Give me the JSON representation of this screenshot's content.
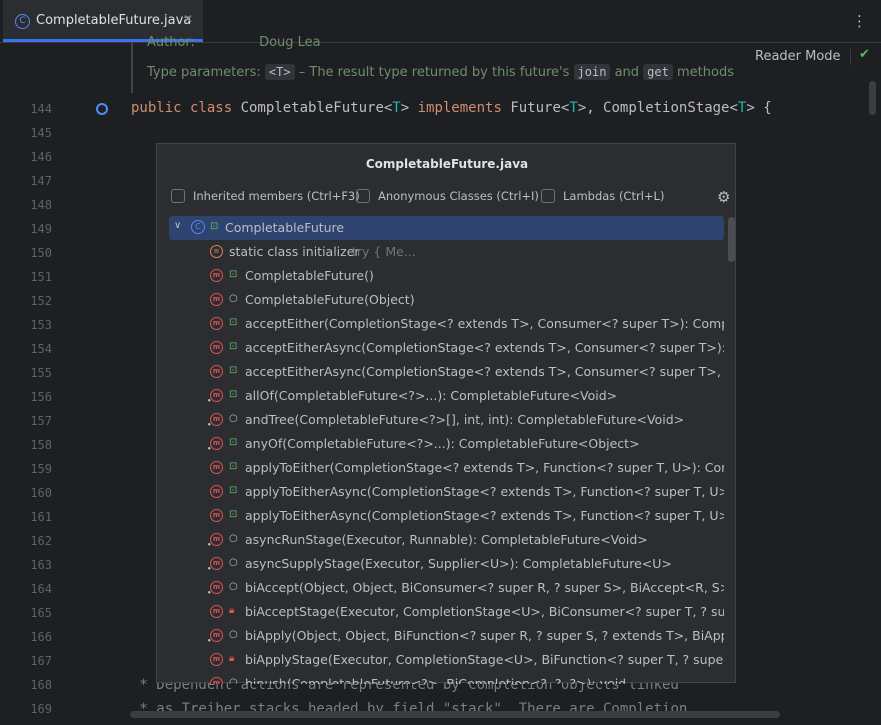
{
  "tab": {
    "title": "CompletableFuture.java",
    "icon": "class-icon",
    "close": "✕"
  },
  "reader_mode": "Reader Mode",
  "doc": {
    "author_label": "Author:",
    "author_value": "Doug Lea",
    "type_params_label": "Type parameters:",
    "type_param_code": "<T>",
    "type_param_desc": " – The result type returned by this future's ",
    "join_code": "join",
    "and_text": " and ",
    "get_code": "get",
    "methods_text": " methods"
  },
  "line_numbers": [
    "144",
    "145",
    "146",
    "147",
    "148",
    "149",
    "150",
    "151",
    "152",
    "153",
    "154",
    "155",
    "156",
    "157",
    "158",
    "159",
    "160",
    "161",
    "162",
    "163",
    "164",
    "165",
    "166",
    "167",
    "168",
    "169"
  ],
  "code": {
    "l144_kw1": "public class ",
    "l144_name": "CompletableFuture<",
    "l144_t1": "T",
    "l144_close1": "> ",
    "l144_impl": "implements ",
    "l144_fut": "Future<",
    "l144_t2": "T",
    "l144_mid": ">, CompletionStage<",
    "l144_t3": "T",
    "l144_end": "> {",
    "l168": " * Dependent actions are represented by Completion objects linked",
    "l169": " * as Treiber stacks headed by field \"stack\". There are Completion"
  },
  "popup": {
    "title": "CompletableFuture.java",
    "options": [
      "Inherited members (Ctrl+F3)",
      "Anonymous Classes (Ctrl+I)",
      "Lambdas (Ctrl+L)"
    ],
    "root": "CompletableFuture",
    "members": [
      {
        "kind": "static",
        "vis": "none",
        "label": "static class initializer",
        "extra": "try {            Me..."
      },
      {
        "kind": "method",
        "vis": "pub",
        "label": "CompletableFuture()"
      },
      {
        "kind": "method",
        "vis": "pkg",
        "label": "CompletableFuture(Object)"
      },
      {
        "kind": "method",
        "vis": "pub",
        "label": "acceptEither(CompletionStage<? extends T>, Consumer<? super T>): CompletableFu"
      },
      {
        "kind": "method",
        "vis": "pub",
        "label": "acceptEitherAsync(CompletionStage<? extends T>, Consumer<? super T>): Complet"
      },
      {
        "kind": "method",
        "vis": "pub",
        "label": "acceptEitherAsync(CompletionStage<? extends T>, Consumer<? super T>, Executor)"
      },
      {
        "kind": "smethod",
        "vis": "pub",
        "label": "allOf(CompletableFuture<?>...): CompletableFuture<Void>"
      },
      {
        "kind": "smethod",
        "vis": "pkg",
        "label": "andTree(CompletableFuture<?>[], int, int): CompletableFuture<Void>"
      },
      {
        "kind": "smethod",
        "vis": "pub",
        "label": "anyOf(CompletableFuture<?>...): CompletableFuture<Object>"
      },
      {
        "kind": "method",
        "vis": "pub",
        "label": "applyToEither(CompletionStage<? extends T>, Function<? super T, U>): Completable"
      },
      {
        "kind": "method",
        "vis": "pub",
        "label": "applyToEitherAsync(CompletionStage<? extends T>, Function<? super T, U>): Compl"
      },
      {
        "kind": "method",
        "vis": "pub",
        "label": "applyToEitherAsync(CompletionStage<? extends T>, Function<? super T, U>, Executo"
      },
      {
        "kind": "smethod",
        "vis": "pkg",
        "label": "asyncRunStage(Executor, Runnable): CompletableFuture<Void>"
      },
      {
        "kind": "smethod",
        "vis": "pkg",
        "label": "asyncSupplyStage(Executor, Supplier<U>): CompletableFuture<U>"
      },
      {
        "kind": "smethod",
        "vis": "pkg",
        "label": "biAccept(Object, Object, BiConsumer<? super R, ? super S>, BiAccept<R, S>): boolea"
      },
      {
        "kind": "method",
        "vis": "prv",
        "label": "biAcceptStage(Executor, CompletionStage<U>, BiConsumer<? super T, ? super U>): "
      },
      {
        "kind": "smethod",
        "vis": "pkg",
        "label": "biApply(Object, Object, BiFunction<? super R, ? super S, ? extends T>, BiApply<R, S,"
      },
      {
        "kind": "method",
        "vis": "prv",
        "label": "biApplyStage(Executor, CompletionStage<U>, BiFunction<? super T, ? super U, ? ext"
      },
      {
        "kind": "smethod",
        "vis": "pkg",
        "label": "bipush(CompletableFuture<?>, BiCompletion<?, ?, ?>): void"
      }
    ]
  },
  "colors": {
    "selection": "#2e436e",
    "accent": "#3574f0",
    "keyword": "#cf8e6d",
    "type_param": "#16baac"
  }
}
